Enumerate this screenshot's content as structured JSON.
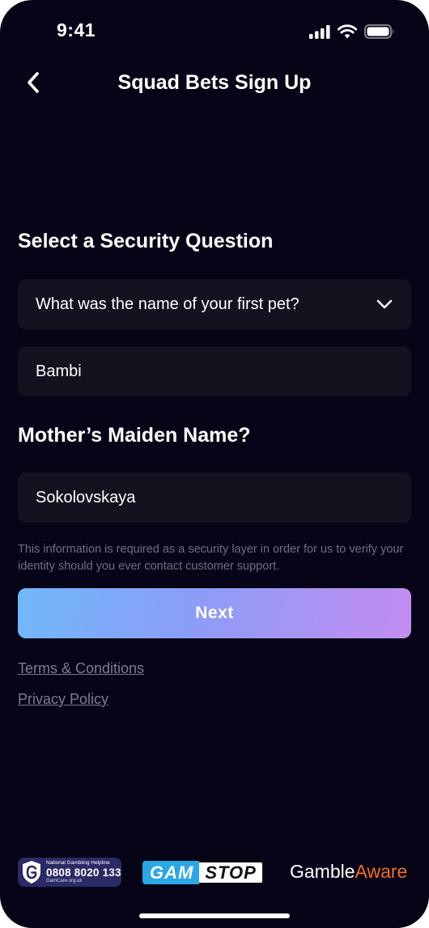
{
  "status_bar": {
    "time": "9:41"
  },
  "header": {
    "title": "Squad Bets Sign Up"
  },
  "security_question": {
    "heading": "Select a Security Question",
    "selected_question": "What was the name of your first pet?",
    "answer_value": "Bambi"
  },
  "maiden_name": {
    "heading": "Mother’s Maiden Name?",
    "value": "Sokolovskaya"
  },
  "helper_text": "This information is required as a security layer in order for us to verify your identity should you ever contact customer support.",
  "next_button": {
    "label": "Next"
  },
  "links": {
    "terms": "Terms & Conditions",
    "privacy": "Privacy Policy"
  },
  "footer": {
    "gamcare": {
      "helpline_label": "National Gambling Helpline",
      "phone": "0808 8020 133",
      "url": "GamCare.org.uk"
    },
    "gamstop": {
      "part1": "GAM",
      "part2": "STOP"
    },
    "gambleaware": {
      "part1": "Gamble",
      "part2": "Aware"
    }
  },
  "colors": {
    "background": "#070417",
    "field": "#15121f",
    "gradient_start": "#71b8fb",
    "gradient_end": "#c48cf0",
    "gambleaware_accent": "#f06d23",
    "gamstop_blue": "#2ba7e4"
  },
  "icons": [
    "signal-icon",
    "wifi-icon",
    "battery-icon",
    "back-chevron-icon",
    "chevron-down-icon",
    "gamcare-logo-icon"
  ]
}
